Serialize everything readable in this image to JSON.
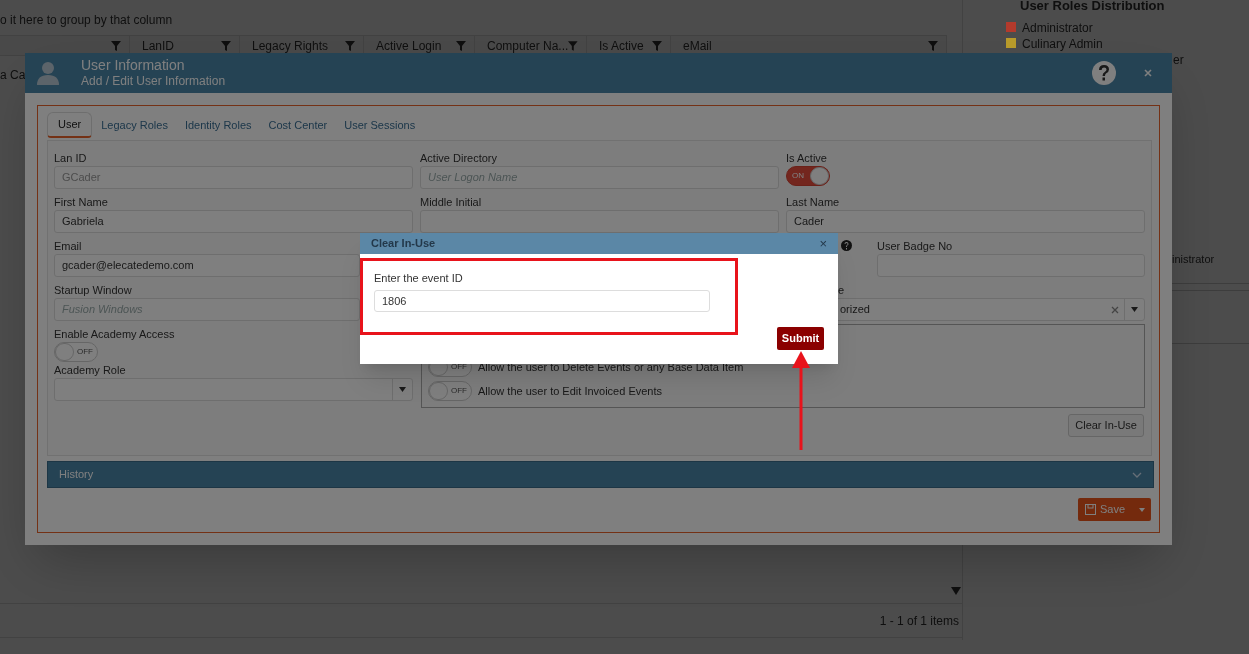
{
  "grid": {
    "group_hint": "o it here to group by that column",
    "columns": [
      {},
      {
        "label": "LanID"
      },
      {
        "label": "Legacy Rights"
      },
      {
        "label": "Active Login"
      },
      {
        "label": "Computer Na..."
      },
      {
        "label": "Is Active"
      },
      {
        "label": "eMail"
      }
    ],
    "rows": [
      [
        "a Ca"
      ]
    ],
    "pager": "1 - 1 of 1 items"
  },
  "legend": {
    "title": "User Roles Distribution",
    "items": [
      {
        "label": "Administrator",
        "color": "#b33a2c"
      },
      {
        "label": "Culinary Admin",
        "color": "#b89a2a"
      },
      {
        "label": "er"
      }
    ],
    "chart_label": "inistrator"
  },
  "dialog": {
    "title": "User Information",
    "subtitle": "Add / Edit User Information",
    "tabs": [
      {
        "label": "User",
        "selected": true
      },
      {
        "label": "Legacy Roles",
        "selected": false
      },
      {
        "label": "Identity Roles",
        "selected": false
      },
      {
        "label": "Cost Center",
        "selected": false
      },
      {
        "label": "User Sessions",
        "selected": false
      }
    ],
    "lan_id": {
      "label": "Lan ID",
      "value": "GCader",
      "disabled": true
    },
    "active_directory": {
      "label": "Active Directory",
      "placeholder": "User Logon Name"
    },
    "is_active": {
      "label": "Is Active",
      "on": true,
      "text": "ON"
    },
    "first_name": {
      "label": "First Name",
      "value": "Gabriela"
    },
    "middle_initial": {
      "label": "Middle Initial"
    },
    "last_name": {
      "label": "Last Name",
      "value": "Cader"
    },
    "email": {
      "label": "Email",
      "value": "gcader@elecatedemo.com"
    },
    "user_badge_no": {
      "label": "User Badge No"
    },
    "startup_window": {
      "label": "Startup Window",
      "placeholder": "Fusion Windows"
    },
    "role_select": {
      "label": "e",
      "value": "orized"
    },
    "academy_access": {
      "label": "Enable Academy Access",
      "on": false,
      "text": "OFF"
    },
    "academy_role": {
      "label": "Academy Role"
    },
    "permissions": [
      {
        "label": "Allow the user to Delete Events or any Base Data Item",
        "on": false,
        "text": "OFF"
      },
      {
        "label": "Allow the user to Edit Invoiced Events",
        "on": false,
        "text": "OFF"
      }
    ],
    "clear_button": "Clear In-Use",
    "history": "History",
    "save": "Save"
  },
  "popup": {
    "title": "Clear In-Use",
    "close": "×",
    "label": "Enter the event ID",
    "value": "1806",
    "submit": "Submit"
  }
}
